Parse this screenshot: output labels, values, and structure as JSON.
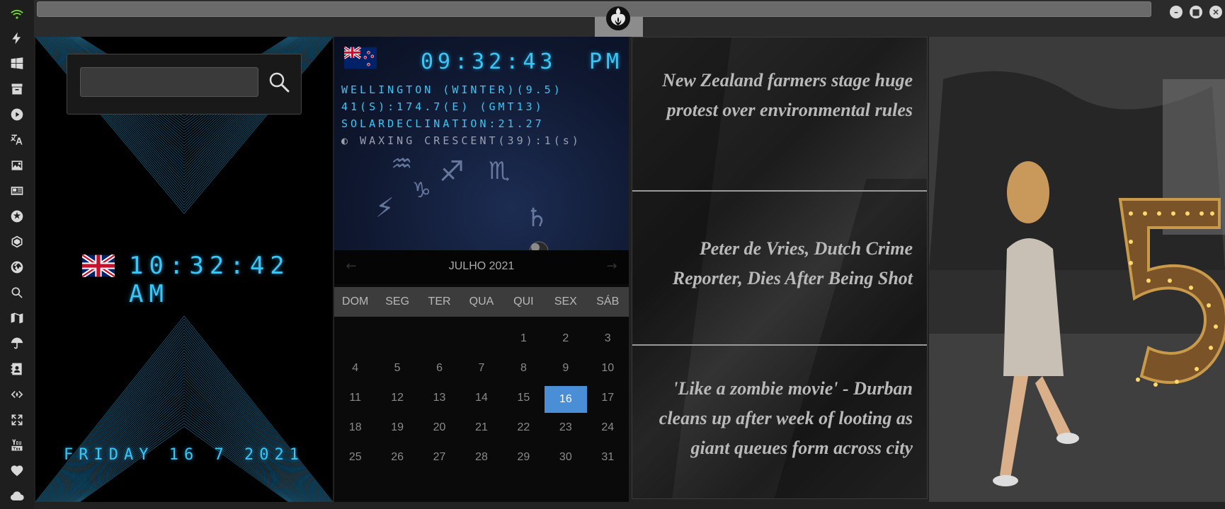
{
  "window": {
    "logo": "rebel-alliance-icon",
    "buttons": [
      "minimize",
      "maximize",
      "close"
    ]
  },
  "sidebar": {
    "icons": [
      "wifi-icon",
      "lightning-icon",
      "windows-icon",
      "archive-icon",
      "play-icon",
      "translate-icon",
      "image-icon",
      "news-icon",
      "atom-icon",
      "hexagon-icon",
      "globe-icon",
      "search-icon",
      "map-icon",
      "umbrella-icon",
      "contacts-icon",
      "code-icon",
      "expand-icon",
      "youtube-icon",
      "heart-icon",
      "cloud-icon"
    ],
    "accent": "#6ed23a"
  },
  "search": {
    "value": "",
    "placeholder": ""
  },
  "uk_clock": {
    "time": "10:32:42 AM",
    "date": "FRIDAY 16 7 2021"
  },
  "nz_clock": {
    "time": "09:32:43",
    "ampm": "PM",
    "line1": "WELLINGTON (WINTER)(9.5)",
    "line2": "41(S):174.7(E) (GMT13)",
    "line3": "SOLARDECLINATION:21.27",
    "moon": "WAXING CRESCENT(39):1(s)"
  },
  "calendar": {
    "title": "JULHO 2021",
    "prev": "←",
    "next": "→",
    "days_of_week": [
      "DOM",
      "SEG",
      "TER",
      "QUA",
      "QUI",
      "SEX",
      "SÁB"
    ],
    "weeks": [
      [
        "",
        "",
        "",
        "",
        "1",
        "2",
        "3"
      ],
      [
        "4",
        "5",
        "6",
        "7",
        "8",
        "9",
        "10"
      ],
      [
        "11",
        "12",
        "13",
        "14",
        "15",
        "16",
        "17"
      ],
      [
        "18",
        "19",
        "20",
        "21",
        "22",
        "23",
        "24"
      ],
      [
        "25",
        "26",
        "27",
        "28",
        "29",
        "30",
        "31"
      ]
    ],
    "selected": "16",
    "accent": "#4a8ed6"
  },
  "news": [
    "New Zealand farmers stage huge protest over environmental rules",
    "Peter de Vries, Dutch Crime Reporter, Dies After Being Shot",
    "'Like a zombie movie' - Durban cleans up after week of looting as giant queues form across city"
  ],
  "colors": {
    "clock_cyan": "#3cc6f5",
    "sidebar_bg": "#1e1e1e"
  }
}
